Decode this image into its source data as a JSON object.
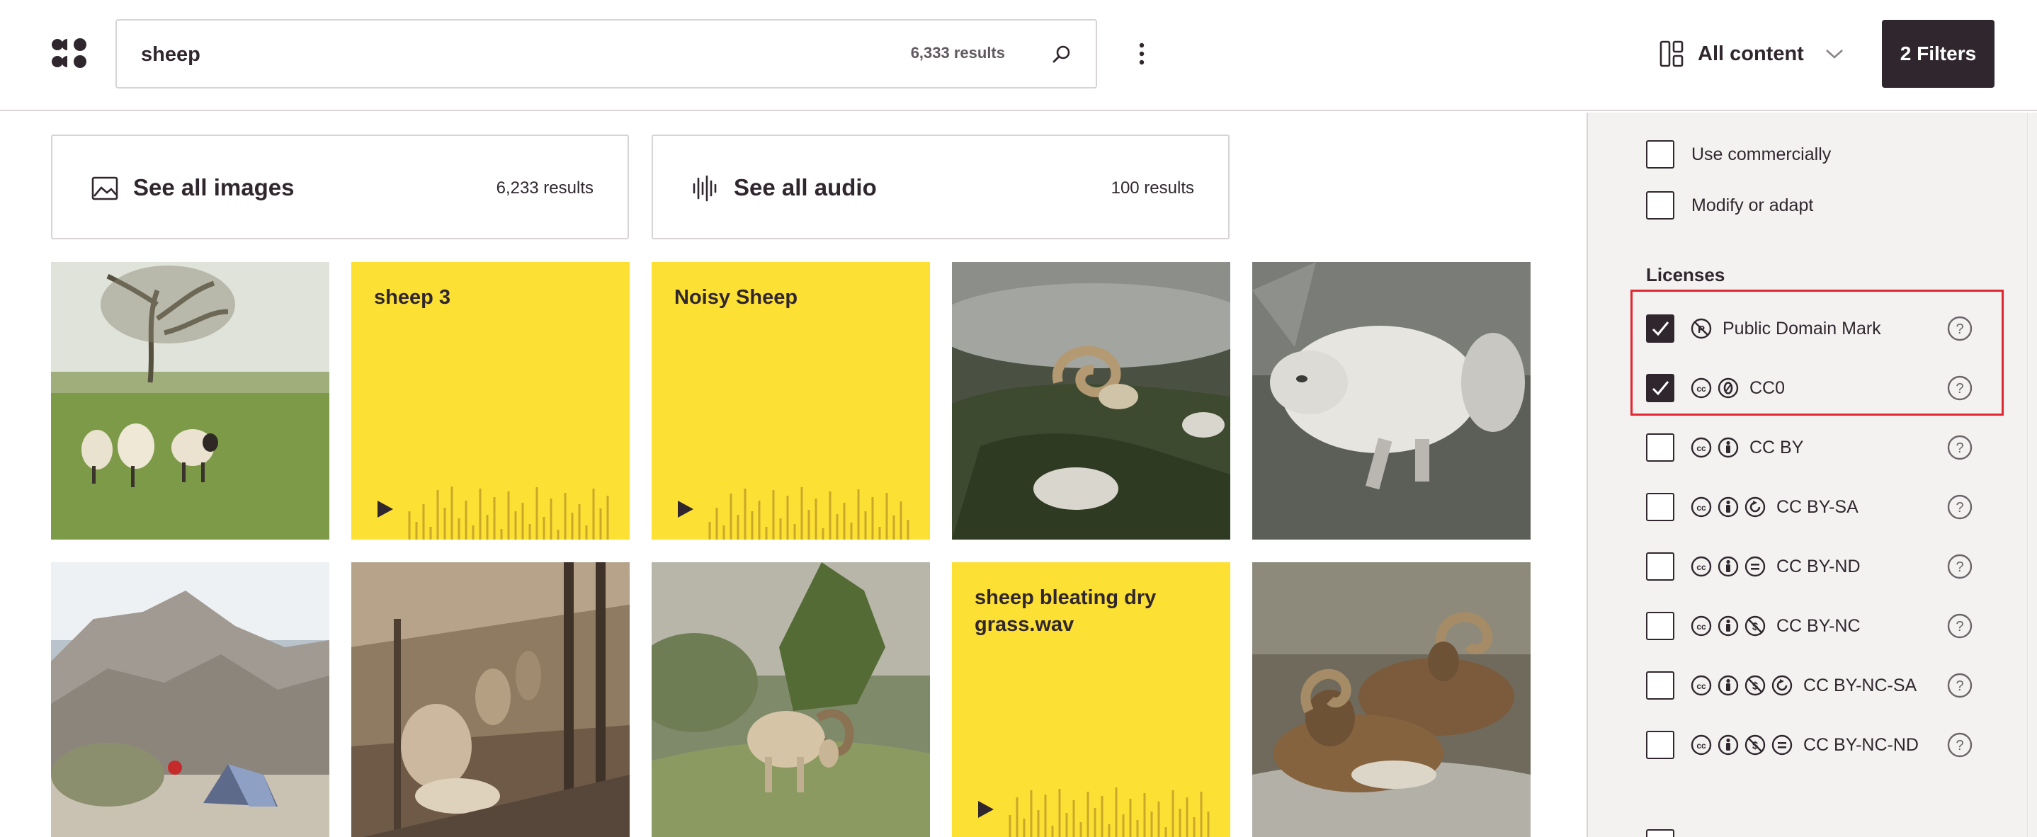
{
  "header": {
    "search_value": "sheep",
    "search_count": "6,333 results",
    "content_type": "All content",
    "filters_label": "2 Filters"
  },
  "see_all": [
    {
      "label": "See all images",
      "count": "6,233 results",
      "icon": "image-icon"
    },
    {
      "label": "See all audio",
      "count": "100 results",
      "icon": "audio-waveform-icon"
    }
  ],
  "grid": [
    {
      "kind": "image",
      "subject": "sheep in a field under a tree"
    },
    {
      "kind": "audio",
      "title": "sheep 3"
    },
    {
      "kind": "audio",
      "title": "Noisy Sheep"
    },
    {
      "kind": "image",
      "subject": "ram horns lying on moss"
    },
    {
      "kind": "image",
      "subject": "fluffy white sheep running"
    },
    {
      "kind": "image",
      "subject": "desert camp with tent and boulders"
    },
    {
      "kind": "image",
      "subject": "sepia sheep shearing shed"
    },
    {
      "kind": "image",
      "subject": "bighorn ram grazing on hillside"
    },
    {
      "kind": "audio",
      "title": "sheep bleating dry grass.wav"
    },
    {
      "kind": "image",
      "subject": "two bighorn rams resting in snow"
    }
  ],
  "sidebar": {
    "use_options": [
      {
        "label": "Use commercially",
        "checked": false
      },
      {
        "label": "Modify or adapt",
        "checked": false
      }
    ],
    "licenses_title": "Licenses",
    "licenses": [
      {
        "label": "Public Domain Mark",
        "checked": true,
        "icons": [
          "pdm-icon"
        ]
      },
      {
        "label": "CC0",
        "checked": true,
        "icons": [
          "cc-icon",
          "zero-icon"
        ]
      },
      {
        "label": "CC BY",
        "checked": false,
        "icons": [
          "cc-icon",
          "by-icon"
        ]
      },
      {
        "label": "CC BY-SA",
        "checked": false,
        "icons": [
          "cc-icon",
          "by-icon",
          "sa-icon"
        ]
      },
      {
        "label": "CC BY-ND",
        "checked": false,
        "icons": [
          "cc-icon",
          "by-icon",
          "nd-icon"
        ]
      },
      {
        "label": "CC BY-NC",
        "checked": false,
        "icons": [
          "cc-icon",
          "by-icon",
          "nc-icon"
        ]
      },
      {
        "label": "CC BY-NC-SA",
        "checked": false,
        "icons": [
          "cc-icon",
          "by-icon",
          "nc-icon",
          "sa-icon"
        ]
      },
      {
        "label": "CC BY-NC-ND",
        "checked": false,
        "icons": [
          "cc-icon",
          "by-icon",
          "nc-icon",
          "nd-icon"
        ]
      }
    ]
  },
  "colors": {
    "text": "#30272e",
    "audio_tile": "#fde034",
    "sidebar_bg": "#f3f2f1",
    "highlight": "#e3262f"
  }
}
